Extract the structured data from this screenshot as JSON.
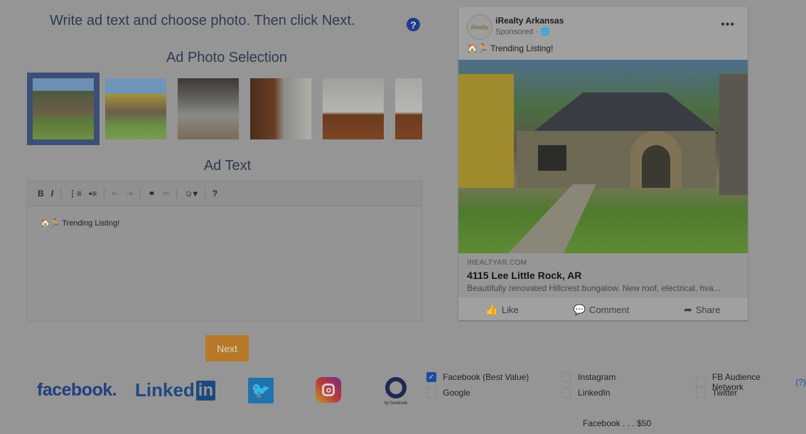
{
  "header": {
    "title": "Write ad text and choose photo. Then click Next."
  },
  "photo_section": {
    "title": "Ad Photo Selection",
    "selected_index": 0,
    "count_visible": 6
  },
  "ad_text_section": {
    "title": "Ad Text",
    "toolbar": [
      "B",
      "I",
      "ordered-list",
      "bullet-list",
      "outdent",
      "indent",
      "link",
      "unlink",
      "emoji",
      "?"
    ],
    "content": "🏠🏃 Trending Listing!"
  },
  "next_button": {
    "label": "Next"
  },
  "platform_logos": {
    "facebook": "facebook.",
    "linkedin_text": "Linked",
    "linkedin_box": "in",
    "audience_sub": "by facebook"
  },
  "placements": [
    {
      "label": "Facebook (Best Value)",
      "checked": true
    },
    {
      "label": "Instagram",
      "checked": false
    },
    {
      "label": "FB Audience Network",
      "checked": false,
      "help": "(?)"
    },
    {
      "label": "Google",
      "checked": false
    },
    {
      "label": "LinkedIn",
      "checked": false
    },
    {
      "label": "Twitter",
      "checked": false
    }
  ],
  "price_summary": "Facebook . . . $50",
  "preview": {
    "avatar_text": "iRealty",
    "page_name": "iRealty Arkansas",
    "sponsored": "Sponsored · 🌐",
    "more": "•••",
    "post_text": "🏠🏃 Trending Listing!",
    "domain": "IREALTYAR.COM",
    "headline": "4115 Lee Little Rock, AR",
    "description": "Beautifully renovated Hillcrest bungalow. New roof, electrical, hva...",
    "actions": {
      "like": "Like",
      "comment": "Comment",
      "share": "Share"
    }
  },
  "colors": {
    "accent": "#b7782a",
    "brand_blue": "#1f4c9f",
    "text": "#2f3a52"
  }
}
